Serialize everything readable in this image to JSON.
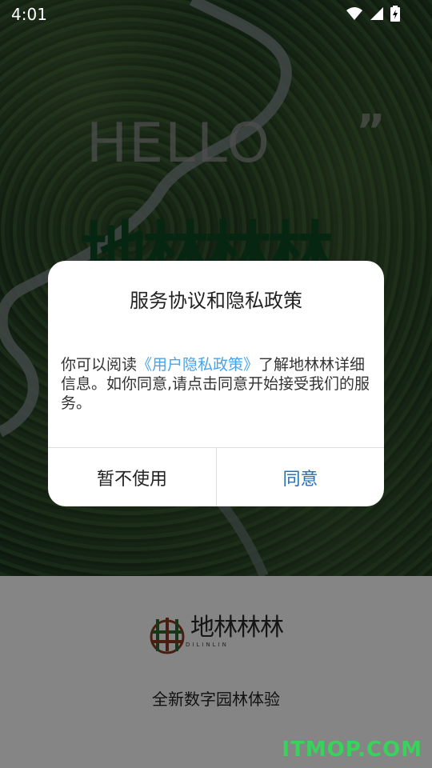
{
  "status_bar": {
    "time": "4:01"
  },
  "splash": {
    "hello": "HELLO",
    "quote": "”",
    "brand_big": "地林林林"
  },
  "dialog": {
    "title": "服务协议和隐私政策",
    "body_prefix": "你可以阅读",
    "link_text": "《用户隐私政策》",
    "body_suffix": "了解地林林详细信息。如你同意,请点击同意开始接受我们的服务。",
    "decline_label": "暂不使用",
    "agree_label": "同意",
    "link_color": "#4aa3e8",
    "agree_color": "#2a6fb0"
  },
  "footer": {
    "logo_name": "地林林林",
    "logo_sub": "DILINLIN",
    "tagline": "全新数字园林体验"
  },
  "watermark": "ITMOP.COM",
  "colors": {
    "brand_green": "#0e4a22",
    "watermark_green": "#39d25a"
  }
}
